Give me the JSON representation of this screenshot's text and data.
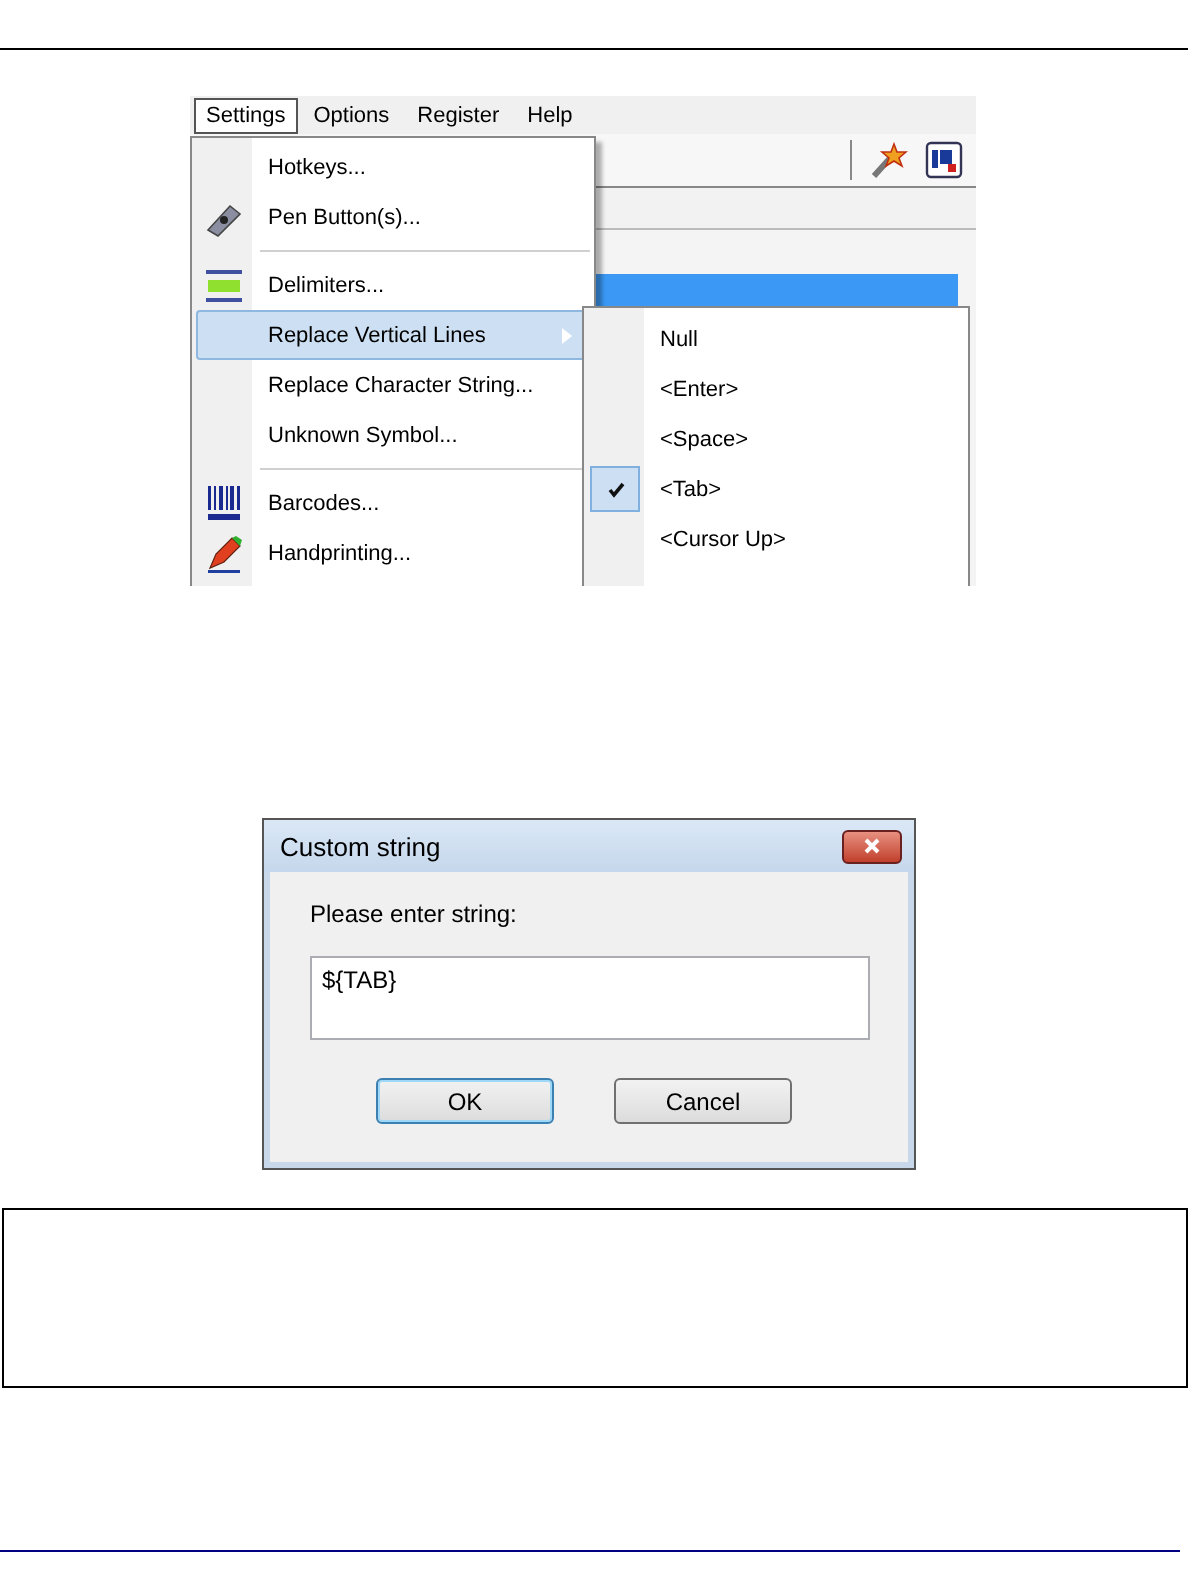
{
  "menu_screenshot": {
    "menubar": [
      {
        "label": "Settings",
        "selected": true
      },
      {
        "label": "Options",
        "selected": false
      },
      {
        "label": "Register",
        "selected": false
      },
      {
        "label": "Help",
        "selected": false
      }
    ],
    "settings_menu": [
      {
        "kind": "item",
        "label": "Hotkeys...",
        "selected": false,
        "submenu": false
      },
      {
        "kind": "icon_item",
        "label": "Pen Button(s)...",
        "selected": false,
        "submenu": false
      },
      {
        "kind": "separator"
      },
      {
        "kind": "icon_item",
        "label": "Delimiters...",
        "selected": false,
        "submenu": false
      },
      {
        "kind": "item",
        "label": "Replace Vertical Lines",
        "selected": true,
        "submenu": true
      },
      {
        "kind": "item",
        "label": "Replace Character String...",
        "selected": false,
        "submenu": false
      },
      {
        "kind": "item",
        "label": "Unknown Symbol...",
        "selected": false,
        "submenu": false
      },
      {
        "kind": "separator"
      },
      {
        "kind": "icon_item",
        "label": "Barcodes...",
        "selected": false,
        "submenu": false
      },
      {
        "kind": "icon_item",
        "label": "Handprinting...",
        "selected": false,
        "submenu": false
      }
    ],
    "submenu": [
      {
        "label": "Null",
        "checked": false
      },
      {
        "label": "<Enter>",
        "checked": false
      },
      {
        "label": "<Space>",
        "checked": false
      },
      {
        "label": "<Tab>",
        "checked": true
      },
      {
        "label": "<Cursor Up>",
        "checked": false
      }
    ]
  },
  "dialog": {
    "title": "Custom string",
    "prompt": "Please enter string:",
    "value": "${TAB}",
    "buttons": [
      {
        "label": "OK",
        "default": true
      },
      {
        "label": "Cancel",
        "default": false
      }
    ]
  }
}
